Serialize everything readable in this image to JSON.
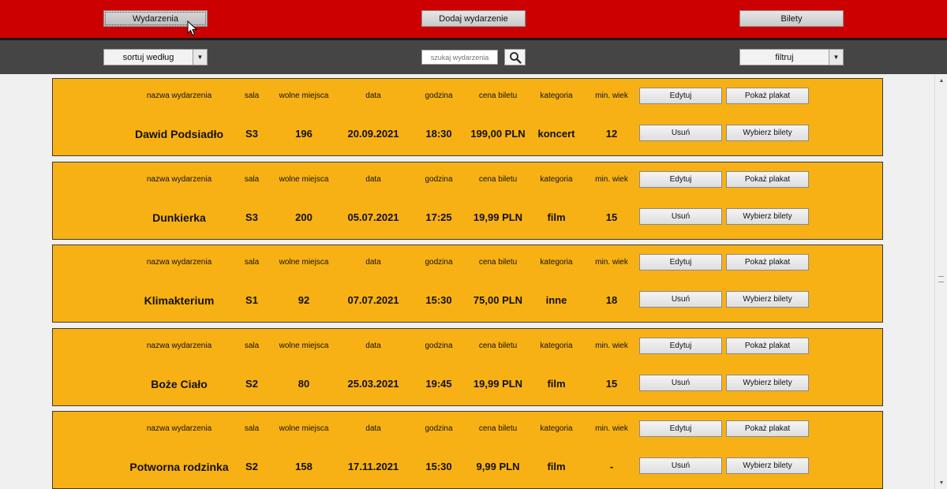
{
  "nav": {
    "events_label": "Wydarzenia",
    "add_event_label": "Dodaj wydarzenie",
    "tickets_label": "Bilety"
  },
  "toolbar": {
    "sort_label": "sortuj według",
    "search_placeholder": "szukaj wydarzenia",
    "filter_label": "filtruj"
  },
  "columns": {
    "name": "nazwa wydarzenia",
    "hall": "sala",
    "free_seats": "wolne miejsca",
    "date": "data",
    "time": "godzina",
    "price": "cena biletu",
    "category": "kategoria",
    "min_age": "min. wiek"
  },
  "actions": {
    "edit": "Edytuj",
    "show_poster": "Pokaż plakat",
    "delete": "Usuń",
    "choose_tickets": "Wybierz bilety"
  },
  "events": [
    {
      "name": "Dawid Podsiadło",
      "hall": "S3",
      "free_seats": "196",
      "date": "20.09.2021",
      "time": "18:30",
      "price": "199,00 PLN",
      "category": "koncert",
      "min_age": "12"
    },
    {
      "name": "Dunkierka",
      "hall": "S3",
      "free_seats": "200",
      "date": "05.07.2021",
      "time": "17:25",
      "price": "19,99 PLN",
      "category": "film",
      "min_age": "15"
    },
    {
      "name": "Klimakterium",
      "hall": "S1",
      "free_seats": "92",
      "date": "07.07.2021",
      "time": "15:30",
      "price": "75,00 PLN",
      "category": "inne",
      "min_age": "18"
    },
    {
      "name": "Boże Ciało",
      "hall": "S2",
      "free_seats": "80",
      "date": "25.03.2021",
      "time": "19:45",
      "price": "19,99 PLN",
      "category": "film",
      "min_age": "15"
    },
    {
      "name": "Potworna rodzinka",
      "hall": "S2",
      "free_seats": "158",
      "date": "17.11.2021",
      "time": "15:30",
      "price": "9,99 PLN",
      "category": "film",
      "min_age": "-"
    }
  ],
  "colors": {
    "nav_background": "#cc0000",
    "toolbar_background": "#454545",
    "card_background": "#f8b114"
  }
}
